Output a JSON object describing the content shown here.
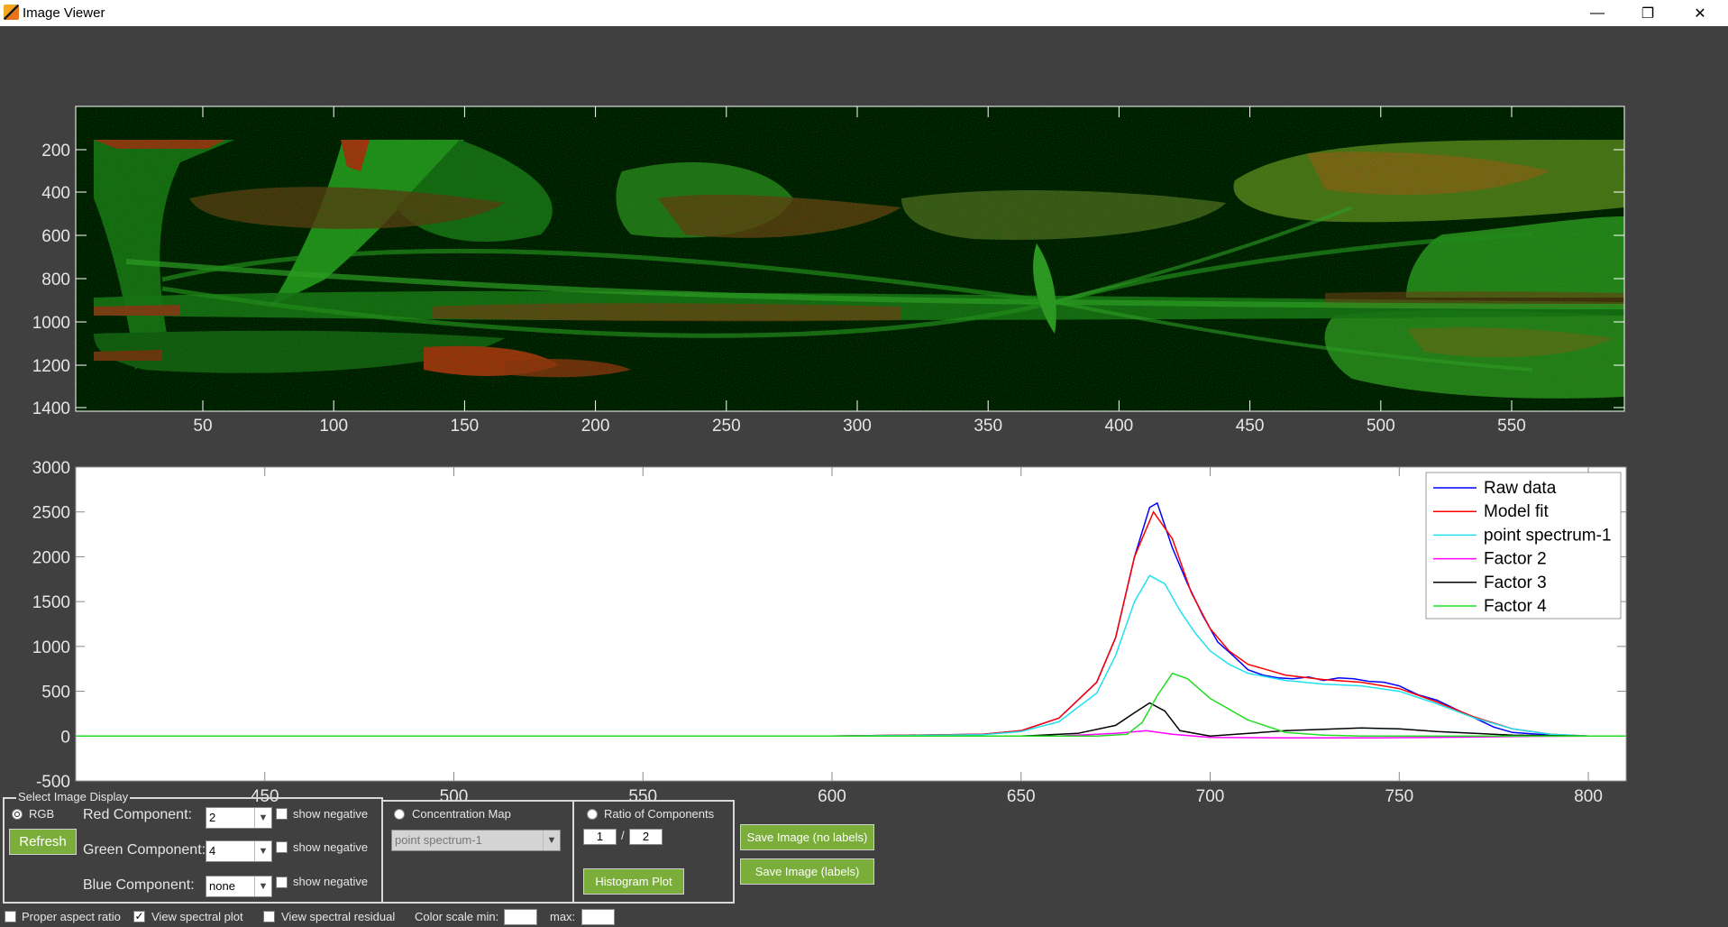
{
  "window": {
    "title": "Image Viewer",
    "minimize_label": "—",
    "maximize_label": "❐",
    "close_label": "✕"
  },
  "image_plot": {
    "y_ticks": [
      "200",
      "400",
      "600",
      "800",
      "1000",
      "1200",
      "1400"
    ],
    "x_ticks": [
      "50",
      "100",
      "150",
      "200",
      "250",
      "300",
      "350",
      "400",
      "450",
      "500",
      "550"
    ]
  },
  "chart_data": {
    "type": "line",
    "title": "",
    "xlabel": "",
    "ylabel": "",
    "xlim": [
      400,
      810
    ],
    "ylim": [
      -500,
      3000
    ],
    "x_ticks": [
      450,
      500,
      550,
      600,
      650,
      700,
      750,
      800
    ],
    "y_ticks": [
      3000,
      2500,
      2000,
      1500,
      1000,
      500,
      0,
      -500
    ],
    "legend_position": "top-right",
    "series": [
      {
        "name": "Raw data",
        "color": "#0000ff",
        "x": [
          400,
          600,
          640,
          650,
          660,
          670,
          675,
          680,
          684,
          686,
          688,
          690,
          694,
          698,
          702,
          706,
          710,
          714,
          718,
          722,
          726,
          730,
          734,
          738,
          742,
          746,
          750,
          755,
          760,
          765,
          770,
          775,
          780,
          790,
          800,
          810
        ],
        "y": [
          0,
          0,
          20,
          60,
          200,
          600,
          1100,
          2000,
          2550,
          2600,
          2350,
          2100,
          1700,
          1350,
          1050,
          900,
          740,
          680,
          650,
          640,
          660,
          620,
          650,
          640,
          610,
          600,
          560,
          460,
          400,
          300,
          200,
          100,
          40,
          10,
          0,
          0
        ]
      },
      {
        "name": "Model fit",
        "color": "#ff0000",
        "x": [
          400,
          600,
          640,
          650,
          660,
          670,
          675,
          680,
          685,
          690,
          695,
          700,
          705,
          710,
          720,
          730,
          740,
          750,
          760,
          770,
          780,
          790,
          800,
          810
        ],
        "y": [
          0,
          0,
          20,
          60,
          200,
          600,
          1100,
          2000,
          2500,
          2200,
          1600,
          1200,
          950,
          800,
          680,
          630,
          600,
          530,
          380,
          210,
          80,
          20,
          0,
          0
        ]
      },
      {
        "name": "point spectrum-1",
        "color": "#22e0f0",
        "x": [
          400,
          600,
          640,
          650,
          660,
          670,
          675,
          680,
          684,
          688,
          692,
          696,
          700,
          705,
          710,
          720,
          730,
          740,
          750,
          760,
          770,
          780,
          790,
          800,
          810
        ],
        "y": [
          0,
          0,
          15,
          50,
          160,
          480,
          900,
          1500,
          1790,
          1700,
          1400,
          1150,
          950,
          800,
          700,
          620,
          580,
          560,
          500,
          360,
          200,
          80,
          20,
          0,
          0
        ]
      },
      {
        "name": "Factor 2",
        "color": "#ff00ff",
        "x": [
          400,
          660,
          675,
          683,
          690,
          700,
          720,
          740,
          760,
          780,
          800,
          810
        ],
        "y": [
          0,
          0,
          30,
          60,
          20,
          -15,
          -20,
          -20,
          -15,
          -5,
          0,
          0
        ]
      },
      {
        "name": "Factor 3",
        "color": "#000000",
        "x": [
          400,
          650,
          665,
          675,
          680,
          684,
          688,
          692,
          700,
          720,
          740,
          750,
          760,
          780,
          800,
          810
        ],
        "y": [
          0,
          0,
          30,
          120,
          260,
          370,
          280,
          60,
          0,
          60,
          90,
          80,
          50,
          10,
          0,
          0
        ]
      },
      {
        "name": "Factor 4",
        "color": "#22dd22",
        "x": [
          400,
          670,
          678,
          682,
          686,
          690,
          694,
          700,
          710,
          720,
          730,
          740,
          760,
          780,
          800,
          810
        ],
        "y": [
          0,
          0,
          20,
          150,
          450,
          700,
          640,
          420,
          180,
          40,
          10,
          0,
          0,
          0,
          0,
          0
        ]
      }
    ]
  },
  "controls": {
    "select_display_label": "Select Image Display",
    "rgb_label": "RGB",
    "refresh_label": "Refresh",
    "red_label": "Red Component:",
    "red_value": "2",
    "green_label": "Green Component:",
    "green_value": "4",
    "blue_label": "Blue Component:",
    "blue_value": "none",
    "show_negative_label": "show negative",
    "concentration_label": "Concentration Map",
    "concentration_value": "point spectrum-1",
    "ratio_label": "Ratio of Components",
    "ratio_a": "1",
    "ratio_sep": "/",
    "ratio_b": "2",
    "histogram_label": "Histogram Plot",
    "save_nolabels_label": "Save Image (no labels)",
    "save_labels_label": "Save Image (labels)"
  },
  "bottom_bar": {
    "proper_aspect_label": "Proper aspect ratio",
    "view_spectral_plot_label": "View spectral plot",
    "view_spectral_residual_label": "View spectral residual",
    "color_min_label": "Color scale min:",
    "color_max_label": "max:",
    "color_min_value": "",
    "color_max_value": ""
  }
}
